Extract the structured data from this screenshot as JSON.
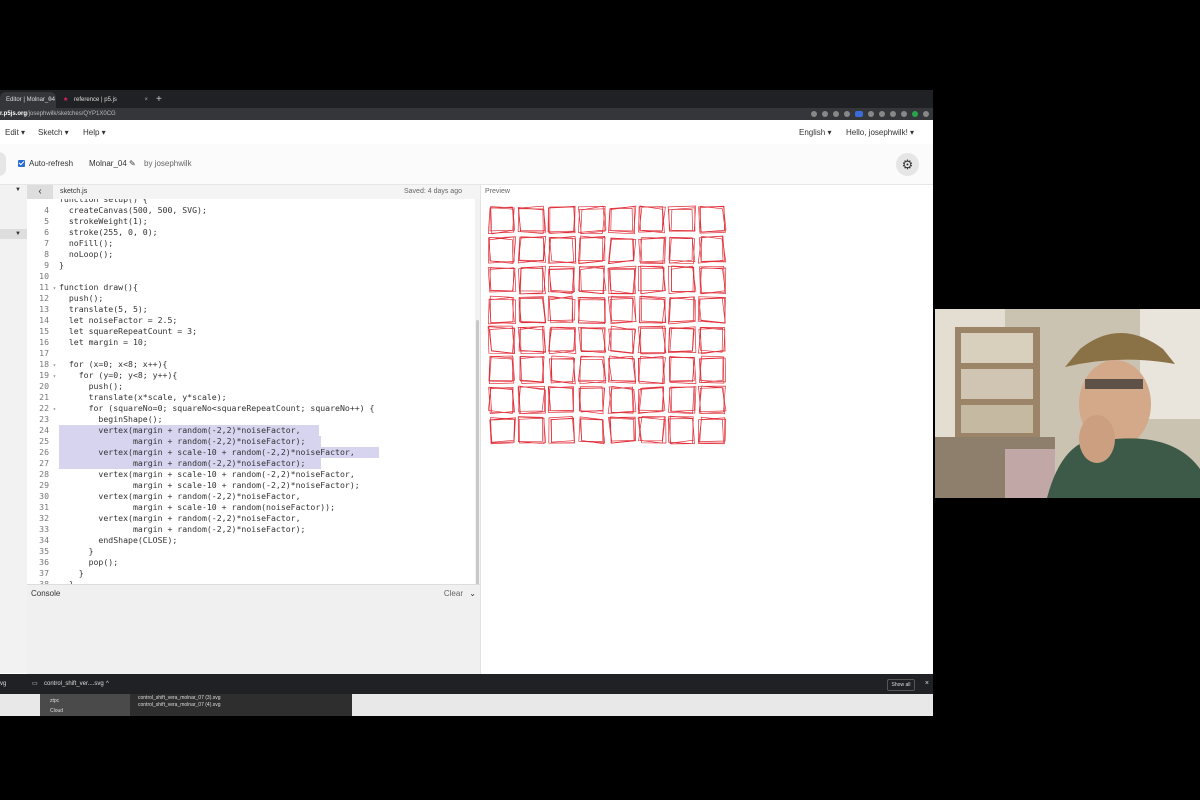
{
  "browser": {
    "tabs": [
      {
        "label": "Editor | Molnar_04",
        "close": "×",
        "active": true
      },
      {
        "label": "reference | p5.js",
        "close": "×",
        "active": false
      }
    ],
    "new_tab": "+",
    "url_bold": "r.p5js.org",
    "url_rest": "/josephwilk/sketches/QYP1X0CG"
  },
  "menu": {
    "edit": "Edit ▾",
    "sketch": "Sketch ▾",
    "help": "Help ▾",
    "language": "English ▾",
    "user": "Hello, josephwilk! ▾"
  },
  "toolbar": {
    "auto_refresh": "Auto-refresh",
    "sketch_name": "Molnar_04 ✎",
    "author": "by josephwilk",
    "settings_icon": "gear-icon"
  },
  "editor": {
    "collapse_glyph": "‹",
    "file_name": "sketch.js",
    "saved_status": "Saved: 4 days ago",
    "lines": [
      {
        "n": "",
        "fold": "",
        "text": "function setup() {"
      },
      {
        "n": "4",
        "fold": "",
        "text": "  createCanvas(500, 500, SVG);"
      },
      {
        "n": "5",
        "fold": "",
        "text": "  strokeWeight(1);"
      },
      {
        "n": "6",
        "fold": "",
        "text": "  stroke(255, 0, 0);"
      },
      {
        "n": "7",
        "fold": "",
        "text": "  noFill();"
      },
      {
        "n": "8",
        "fold": "",
        "text": "  noLoop();"
      },
      {
        "n": "9",
        "fold": "",
        "text": "}"
      },
      {
        "n": "10",
        "fold": "",
        "text": ""
      },
      {
        "n": "11",
        "fold": "▾",
        "text": "function draw(){"
      },
      {
        "n": "12",
        "fold": "",
        "text": "  push();"
      },
      {
        "n": "13",
        "fold": "",
        "text": "  translate(5, 5);"
      },
      {
        "n": "14",
        "fold": "",
        "text": "  let noiseFactor = 2.5;"
      },
      {
        "n": "15",
        "fold": "",
        "text": "  let squareRepeatCount = 3;"
      },
      {
        "n": "16",
        "fold": "",
        "text": "  let margin = 10;"
      },
      {
        "n": "17",
        "fold": "",
        "text": ""
      },
      {
        "n": "18",
        "fold": "▾",
        "text": "  for (x=0; x<8; x++){"
      },
      {
        "n": "19",
        "fold": "▾",
        "text": "    for (y=0; y<8; y++){"
      },
      {
        "n": "20",
        "fold": "",
        "text": "      push();"
      },
      {
        "n": "21",
        "fold": "",
        "text": "      translate(x*scale, y*scale);"
      },
      {
        "n": "22",
        "fold": "▾",
        "text": "      for (squareNo=0; squareNo<squareRepeatCount; squareNo++) {"
      },
      {
        "n": "23",
        "fold": "",
        "text": "        beginShape();"
      },
      {
        "n": "24",
        "fold": "",
        "text": "        vertex(margin + random(-2,2)*noiseFactor,"
      },
      {
        "n": "25",
        "fold": "",
        "text": "               margin + random(-2,2)*noiseFactor);"
      },
      {
        "n": "26",
        "fold": "",
        "text": "        vertex(margin + scale-10 + random(-2,2)*noiseFactor,"
      },
      {
        "n": "27",
        "fold": "",
        "text": "               margin + random(-2,2)*noiseFactor);"
      },
      {
        "n": "28",
        "fold": "",
        "text": "        vertex(margin + scale-10 + random(-2,2)*noiseFactor,"
      },
      {
        "n": "29",
        "fold": "",
        "text": "               margin + scale-10 + random(-2,2)*noiseFactor);"
      },
      {
        "n": "30",
        "fold": "",
        "text": "        vertex(margin + random(-2,2)*noiseFactor,"
      },
      {
        "n": "31",
        "fold": "",
        "text": "               margin + scale-10 + random(noiseFactor));"
      },
      {
        "n": "32",
        "fold": "",
        "text": "        vertex(margin + random(-2,2)*noiseFactor,"
      },
      {
        "n": "33",
        "fold": "",
        "text": "               margin + random(-2,2)*noiseFactor);"
      },
      {
        "n": "34",
        "fold": "",
        "text": "        endShape(CLOSE);"
      },
      {
        "n": "35",
        "fold": "",
        "text": "      }"
      },
      {
        "n": "36",
        "fold": "",
        "text": "      pop();"
      },
      {
        "n": "37",
        "fold": "",
        "text": "    }"
      },
      {
        "n": "38",
        "fold": "",
        "text": "  }"
      }
    ]
  },
  "console": {
    "title": "Console",
    "clear": "Clear",
    "chevron": "⌄"
  },
  "preview": {
    "label": "Preview",
    "grid": {
      "cols": 8,
      "rows": 8,
      "repeats": 3,
      "stroke_color": "#e0303a"
    }
  },
  "downloads": {
    "file_label": "control_shift_ver....svg",
    "chevron": "^",
    "show_all": "Show all",
    "close": "×"
  },
  "desktop": {
    "items": [
      "ztpc",
      "Cloud"
    ],
    "files": [
      "control_shift_vera_molnar_07 (3).svg",
      "control_shift_vera_molnar_07 (4).svg"
    ]
  }
}
